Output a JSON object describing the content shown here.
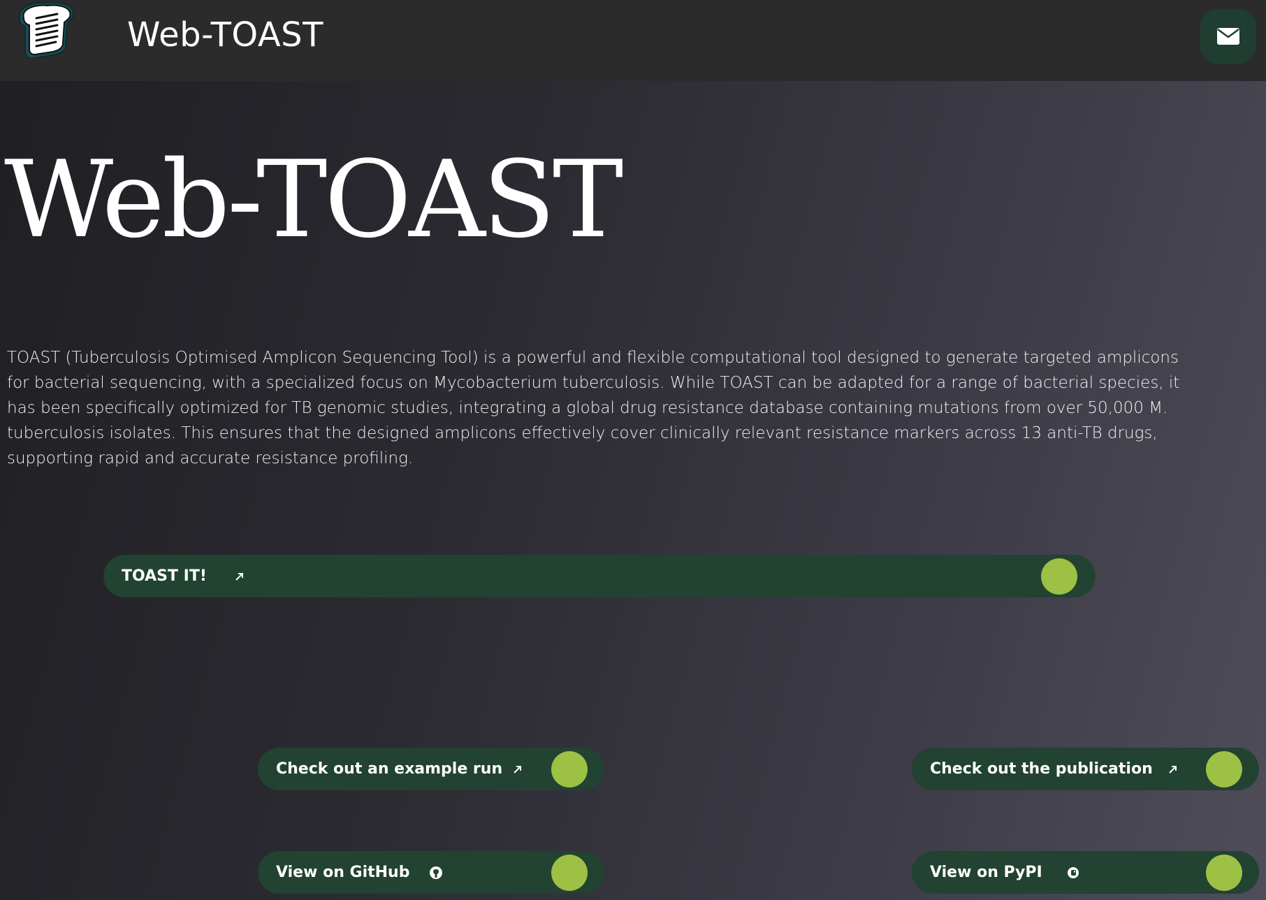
{
  "header": {
    "brand": "Web-TOAST",
    "logo_icon": "toast-logo-icon",
    "mail_icon": "envelope-icon"
  },
  "hero": {
    "title": "Web-TOAST",
    "description": "TOAST (Tuberculosis Optimised Amplicon Sequencing Tool) is a powerful and flexible computational tool designed to generate targeted amplicons for bacterial sequencing, with a specialized focus on Mycobacterium tuberculosis. While TOAST can be adapted for a range of bacterial species, it has been specifically optimized for TB genomic studies, integrating a global drug resistance database containing mutations from over 50,000 M. tuberculosis isolates. This ensures that the designed amplicons effectively cover clinically relevant resistance markers across 13 anti-TB drugs, supporting rapid and accurate resistance profiling."
  },
  "buttons": {
    "toast_it": "TOAST IT!",
    "example_run": "Check out an example run",
    "publication": "Check out the publication",
    "github": "View on GitHub",
    "pypi": "View on PyPI"
  },
  "colors": {
    "button_bg": "#224232",
    "knob": "#9cc144",
    "topbar": "#2b2b2b"
  }
}
